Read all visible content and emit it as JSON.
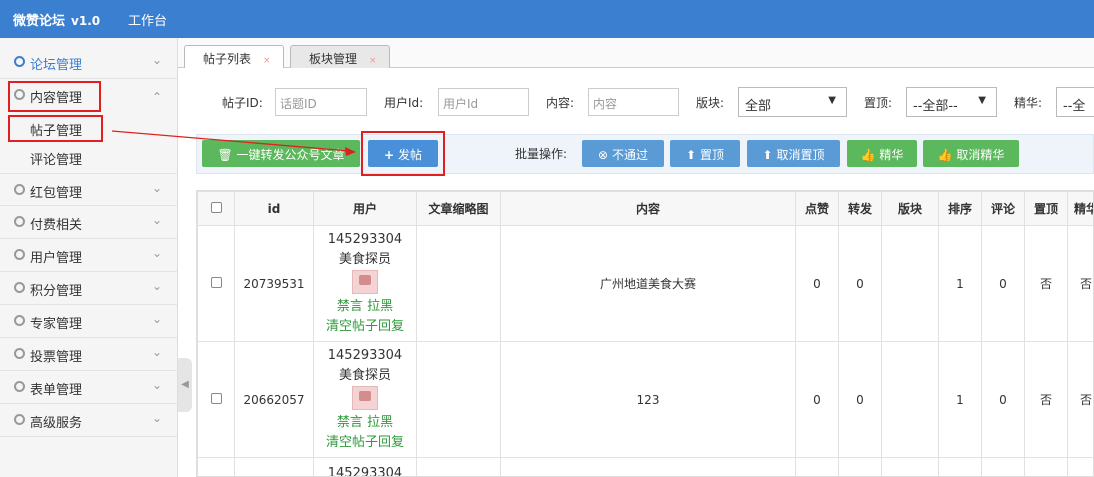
{
  "app": {
    "title": "微赞论坛",
    "version": "v1.0",
    "workbench": "工作台"
  },
  "sidebar": {
    "items": [
      {
        "label": "论坛管理"
      },
      {
        "label": "内容管理"
      },
      {
        "label": "红包管理"
      },
      {
        "label": "付费相关"
      },
      {
        "label": "用户管理"
      },
      {
        "label": "积分管理"
      },
      {
        "label": "专家管理"
      },
      {
        "label": "投票管理"
      },
      {
        "label": "表单管理"
      },
      {
        "label": "高级服务"
      }
    ],
    "sub_items": [
      "帖子管理",
      "评论管理"
    ]
  },
  "tabs": [
    {
      "label": "帖子列表"
    },
    {
      "label": "板块管理"
    }
  ],
  "filters": {
    "post_id_label": "帖子ID:",
    "post_id_placeholder": "话题ID",
    "user_id_label": "用户Id:",
    "user_id_placeholder": "用户Id",
    "content_label": "内容:",
    "content_placeholder": "内容",
    "board_label": "版块:",
    "board_value": "全部",
    "top_label": "置顶:",
    "top_value": "--全部--",
    "essence_label": "精华:",
    "essence_value": "--全"
  },
  "actions": {
    "forward": "一键转发公众号文章",
    "post": "发帖",
    "batch_label": "批量操作:",
    "reject": "不通过",
    "top": "置顶",
    "untop": "取消置顶",
    "essence": "精华",
    "unessence": "取消精华"
  },
  "table": {
    "headers": [
      "id",
      "用户",
      "文章缩略图",
      "内容",
      "点赞",
      "转发",
      "版块",
      "排序",
      "评论",
      "置顶",
      "精华"
    ],
    "rows": [
      {
        "id": "20739531",
        "user_id": "145293304",
        "user_name": "美食探员",
        "mute": "禁言",
        "block": "拉黑",
        "clear": "清空帖子回复",
        "content": "广州地道美食大赛",
        "likes": "0",
        "shares": "0",
        "board": "",
        "order": "1",
        "comments": "0",
        "top": "否",
        "essence": "否"
      },
      {
        "id": "20662057",
        "user_id": "145293304",
        "user_name": "美食探员",
        "mute": "禁言",
        "block": "拉黑",
        "clear": "清空帖子回复",
        "content": "123",
        "likes": "0",
        "shares": "0",
        "board": "",
        "order": "1",
        "comments": "0",
        "top": "否",
        "essence": "否"
      },
      {
        "user_id": "145293304"
      }
    ]
  },
  "colors": {
    "topbar": "#3b7fd0",
    "green": "#5cb85c",
    "blue": "#5b9bd5",
    "highlight": "#e02020"
  }
}
